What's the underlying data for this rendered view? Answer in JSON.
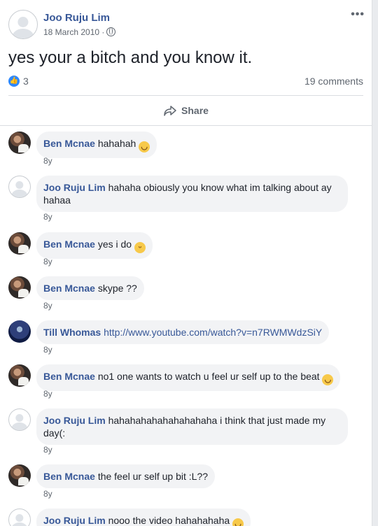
{
  "post": {
    "author": "Joo Ruju Lim",
    "date": "18 March 2010 ·",
    "text": "yes your a bitch and you know it.",
    "likes": "3",
    "comments_count": "19 comments",
    "share_label": "Share",
    "more_label": "•••"
  },
  "comments": [
    {
      "name": "Ben Mcnae",
      "text": "hahahah",
      "emoji": "😆",
      "time": "8y"
    },
    {
      "name": "Joo Ruju Lim",
      "text": "hahaha obiously you know what im talking about ay hahaa",
      "time": "8y"
    },
    {
      "name": "Ben Mcnae",
      "text": "yes i do",
      "emoji": "😛",
      "time": "8y"
    },
    {
      "name": "Ben Mcnae",
      "text": "skype ??",
      "time": "8y"
    },
    {
      "name": "Till Whomas",
      "text": "http://www.youtube.com/watch?v=n7RWMWdzSiY",
      "time": "8y"
    },
    {
      "name": "Ben Mcnae",
      "text": "no1 one wants to watch u feel ur self up to the beat",
      "emoji": "😆",
      "time": "8y"
    },
    {
      "name": "Joo Ruju Lim",
      "text": "hahahahahahahahahaha i think that just made my day(:",
      "time": "8y"
    },
    {
      "name": "Ben Mcnae",
      "text": "the feel ur self up bit :L??",
      "time": "8y"
    },
    {
      "name": "Joo Ruju Lim",
      "text": "nooo the video hahahahaha",
      "emoji": "😆",
      "time": ""
    }
  ],
  "colors": {
    "link": "#385898",
    "like": "#2d88ff",
    "bubble": "#f2f3f5"
  }
}
